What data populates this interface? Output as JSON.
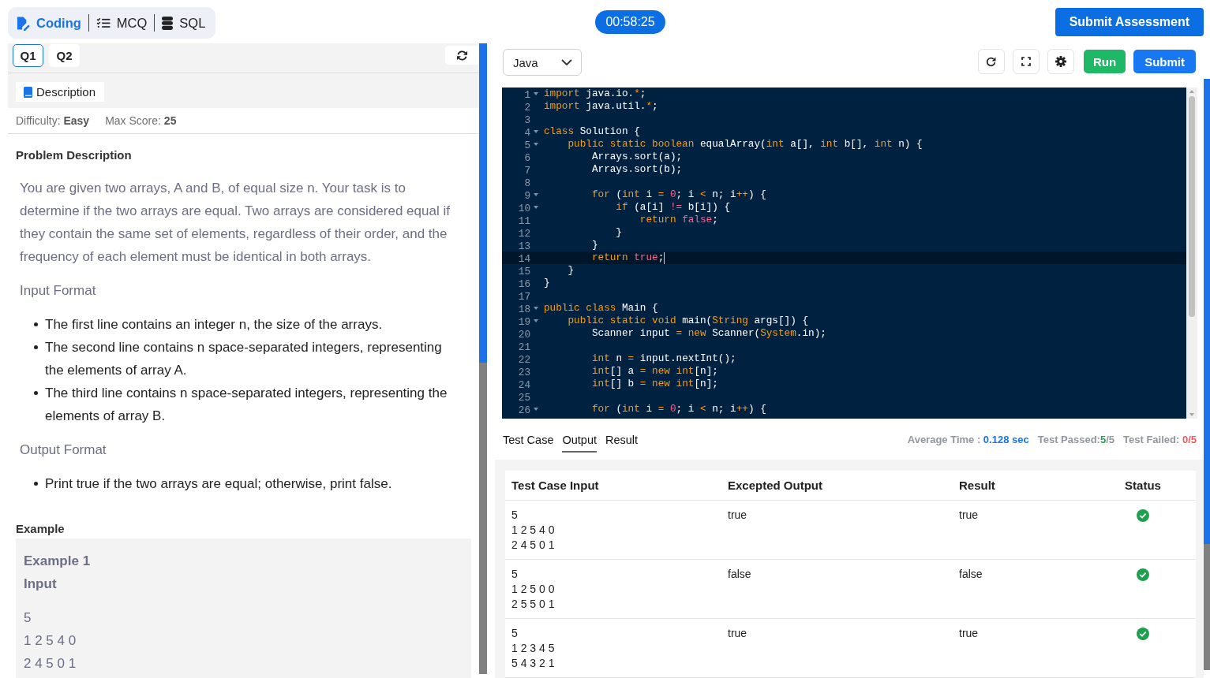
{
  "sections": [
    {
      "label": "Coding",
      "selected": true
    },
    {
      "label": "MCQ",
      "selected": false
    },
    {
      "label": "SQL",
      "selected": false
    }
  ],
  "timer": "00:58:25",
  "submit_assessment": "Submit Assessment",
  "question_tabs": [
    {
      "label": "Q1",
      "selected": true
    },
    {
      "label": "Q2",
      "selected": false
    }
  ],
  "description_tab": {
    "label": "Description",
    "selected": true
  },
  "meta": [
    "Difficulty: **Easy**",
    "Max Score: **25**"
  ],
  "problem": {
    "heading": "Problem Description",
    "statement": "You are given two arrays, A and B, of equal size n. Your task is to determine if the two arrays are equal. Two arrays are considered equal if they contain the same set of elements, regardless of their order, and the frequency of each element must be identical in both arrays.",
    "sections": [
      {
        "heading": "Input Format",
        "bullets": [
          "The first line contains an integer n, the size of the arrays.",
          "The second line contains n space-separated integers, representing the elements of array A.",
          "The third line contains n space-separated integers, representing the elements of array B."
        ]
      },
      {
        "heading": "Output Format",
        "bullets": [
          "Print true if the two arrays are equal; otherwise, print false."
        ]
      }
    ]
  },
  "example": {
    "heading": "Example",
    "title": "Example 1",
    "label": "Input",
    "lines": [
      "5",
      "1 2 5 4 0",
      "2 4 5 0 1"
    ]
  },
  "editor": {
    "language": "Java",
    "run": "Run",
    "submit": "Submit",
    "lines": [
      {
        "number": "1",
        "fold": true,
        "active": false,
        "tokens": [
          {
            "text": "import",
            "kind": "keyword"
          },
          {
            "text": " java.io.",
            "kind": "plain"
          },
          {
            "text": "*",
            "kind": "operator"
          },
          {
            "text": ";",
            "kind": "plain"
          }
        ]
      },
      {
        "number": "2",
        "fold": false,
        "active": false,
        "tokens": [
          {
            "text": "import",
            "kind": "keyword"
          },
          {
            "text": " java.util.",
            "kind": "plain"
          },
          {
            "text": "*",
            "kind": "operator"
          },
          {
            "text": ";",
            "kind": "plain"
          }
        ]
      },
      {
        "number": "3",
        "fold": false,
        "active": false
      },
      {
        "number": "4",
        "fold": true,
        "active": false,
        "tokens": [
          {
            "text": "class",
            "kind": "keyword"
          },
          {
            "text": " Solution {",
            "kind": "plain"
          }
        ]
      },
      {
        "number": "5",
        "fold": true,
        "active": false,
        "tokens": [
          {
            "text": "    public static boolean",
            "kind": "keyword"
          },
          {
            "text": " equalArray(",
            "kind": "plain"
          },
          {
            "text": "int",
            "kind": "keyword"
          },
          {
            "text": " a[], ",
            "kind": "plain"
          },
          {
            "text": "int",
            "kind": "keyword"
          },
          {
            "text": " b[], ",
            "kind": "plain"
          },
          {
            "text": "int",
            "kind": "keyword"
          },
          {
            "text": " n) {",
            "kind": "plain"
          }
        ]
      },
      {
        "number": "6",
        "fold": false,
        "active": false,
        "tokens": [
          {
            "text": "        Arrays.sort(a);",
            "kind": "plain"
          }
        ]
      },
      {
        "number": "7",
        "fold": false,
        "active": false,
        "tokens": [
          {
            "text": "        Arrays.sort(b);",
            "kind": "plain"
          }
        ]
      },
      {
        "number": "8",
        "fold": false,
        "active": false
      },
      {
        "number": "9",
        "fold": true,
        "active": false,
        "tokens": [
          {
            "text": "        for",
            "kind": "keyword"
          },
          {
            "text": " (",
            "kind": "plain"
          },
          {
            "text": "int",
            "kind": "keyword"
          },
          {
            "text": " i ",
            "kind": "plain"
          },
          {
            "text": "=",
            "kind": "operator"
          },
          {
            "text": " 0",
            "kind": "literal"
          },
          {
            "text": "; i ",
            "kind": "plain"
          },
          {
            "text": "<",
            "kind": "operator"
          },
          {
            "text": " n; i",
            "kind": "plain"
          },
          {
            "text": "++",
            "kind": "operator"
          },
          {
            "text": ") {",
            "kind": "plain"
          }
        ]
      },
      {
        "number": "10",
        "fold": true,
        "active": false,
        "tokens": [
          {
            "text": "            if",
            "kind": "keyword"
          },
          {
            "text": " (a[i] ",
            "kind": "plain"
          },
          {
            "text": "!=",
            "kind": "literal"
          },
          {
            "text": " b[i]) {",
            "kind": "plain"
          }
        ]
      },
      {
        "number": "11",
        "fold": false,
        "active": false,
        "tokens": [
          {
            "text": "                return",
            "kind": "keyword"
          },
          {
            "text": " false",
            "kind": "literal"
          },
          {
            "text": ";",
            "kind": "plain"
          }
        ]
      },
      {
        "number": "12",
        "fold": false,
        "active": false,
        "tokens": [
          {
            "text": "            }",
            "kind": "plain"
          }
        ]
      },
      {
        "number": "13",
        "fold": false,
        "active": false,
        "tokens": [
          {
            "text": "        }",
            "kind": "plain"
          }
        ]
      },
      {
        "number": "14",
        "fold": false,
        "active": true,
        "tokens": [
          {
            "text": "        return",
            "kind": "keyword"
          },
          {
            "text": " true",
            "kind": "literal"
          },
          {
            "text": ";",
            "kind": "plain"
          }
        ]
      },
      {
        "number": "15",
        "fold": false,
        "active": false,
        "tokens": [
          {
            "text": "    }",
            "kind": "plain"
          }
        ]
      },
      {
        "number": "16",
        "fold": false,
        "active": false,
        "tokens": [
          {
            "text": "}",
            "kind": "plain"
          }
        ]
      },
      {
        "number": "17",
        "fold": false,
        "active": false
      },
      {
        "number": "18",
        "fold": true,
        "active": false,
        "tokens": [
          {
            "text": "public class",
            "kind": "keyword"
          },
          {
            "text": " Main {",
            "kind": "plain"
          }
        ]
      },
      {
        "number": "19",
        "fold": true,
        "active": false,
        "tokens": [
          {
            "text": "    public static void",
            "kind": "keyword"
          },
          {
            "text": " main(",
            "kind": "plain"
          },
          {
            "text": "String",
            "kind": "keyword"
          },
          {
            "text": " args[]) {",
            "kind": "plain"
          }
        ]
      },
      {
        "number": "20",
        "fold": false,
        "active": false,
        "tokens": [
          {
            "text": "        Scanner input ",
            "kind": "plain"
          },
          {
            "text": "=",
            "kind": "operator"
          },
          {
            "text": " new",
            "kind": "keyword"
          },
          {
            "text": " Scanner(",
            "kind": "plain"
          },
          {
            "text": "System",
            "kind": "keyword"
          },
          {
            "text": ".in);",
            "kind": "plain"
          }
        ]
      },
      {
        "number": "21",
        "fold": false,
        "active": false
      },
      {
        "number": "22",
        "fold": false,
        "active": false,
        "tokens": [
          {
            "text": "        int",
            "kind": "keyword"
          },
          {
            "text": " n ",
            "kind": "plain"
          },
          {
            "text": "=",
            "kind": "operator"
          },
          {
            "text": " input.nextInt();",
            "kind": "plain"
          }
        ]
      },
      {
        "number": "23",
        "fold": false,
        "active": false,
        "tokens": [
          {
            "text": "        int",
            "kind": "keyword"
          },
          {
            "text": "[] a ",
            "kind": "plain"
          },
          {
            "text": "=",
            "kind": "operator"
          },
          {
            "text": " new",
            "kind": "keyword"
          },
          {
            "text": " int",
            "kind": "keyword"
          },
          {
            "text": "[n];",
            "kind": "plain"
          }
        ]
      },
      {
        "number": "24",
        "fold": false,
        "active": false,
        "tokens": [
          {
            "text": "        int",
            "kind": "keyword"
          },
          {
            "text": "[] b ",
            "kind": "plain"
          },
          {
            "text": "=",
            "kind": "operator"
          },
          {
            "text": " new",
            "kind": "keyword"
          },
          {
            "text": " int",
            "kind": "keyword"
          },
          {
            "text": "[n];",
            "kind": "plain"
          }
        ]
      },
      {
        "number": "25",
        "fold": false,
        "active": false
      },
      {
        "number": "26",
        "fold": true,
        "active": false,
        "tokens": [
          {
            "text": "        for",
            "kind": "keyword"
          },
          {
            "text": " (",
            "kind": "plain"
          },
          {
            "text": "int",
            "kind": "keyword"
          },
          {
            "text": " i ",
            "kind": "plain"
          },
          {
            "text": "=",
            "kind": "operator"
          },
          {
            "text": " 0",
            "kind": "literal"
          },
          {
            "text": "; i ",
            "kind": "plain"
          },
          {
            "text": "<",
            "kind": "operator"
          },
          {
            "text": " n; i",
            "kind": "plain"
          },
          {
            "text": "++",
            "kind": "operator"
          },
          {
            "text": ") {",
            "kind": "plain"
          }
        ]
      }
    ]
  },
  "results": {
    "tabs": [
      {
        "label": "Test Case",
        "selected": false
      },
      {
        "label": "Output",
        "selected": true
      },
      {
        "label": "Result",
        "selected": false
      }
    ],
    "stats": [
      {
        "kind": "time",
        "label": "Average Time : ",
        "value": "0.128 sec"
      },
      {
        "kind": "passed",
        "label": "Test Passed:",
        "value": "5",
        "total": "/5"
      },
      {
        "kind": "failed",
        "label": "Test Failed: ",
        "value": "0/5"
      }
    ],
    "table": {
      "columns": [
        "Test Case Input",
        "Excepted Output",
        "Result",
        "Status"
      ],
      "rows": [
        {
          "input": [
            "5",
            "1 2 5 4 0",
            "2 4 5 0 1"
          ],
          "expected": "true",
          "result": "true",
          "passed": true
        },
        {
          "input": [
            "5",
            "1 2 5 0 0",
            "2 5 5 0 1"
          ],
          "expected": "false",
          "result": "false",
          "passed": true
        },
        {
          "input": [
            "5",
            "1 2 3 4 5",
            "5 4 3 2 1"
          ],
          "expected": "true",
          "result": "true",
          "passed": true
        }
      ]
    }
  }
}
